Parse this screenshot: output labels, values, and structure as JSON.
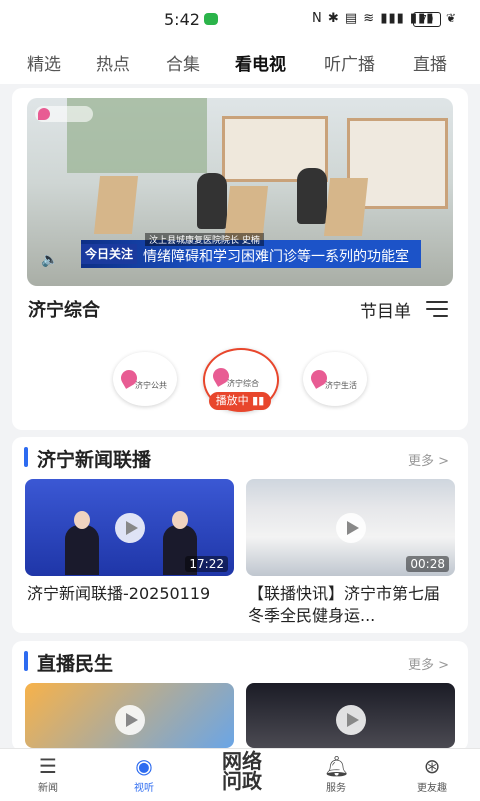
{
  "status": {
    "time": "5:42",
    "icons": "N ✱ ▤ ≋ ▮▮▮ ▮▮▮",
    "battery": "70"
  },
  "tabs": [
    {
      "label": "精选"
    },
    {
      "label": "热点"
    },
    {
      "label": "合集"
    },
    {
      "label": "看电视",
      "active": true
    },
    {
      "label": "听广播"
    },
    {
      "label": "直播"
    }
  ],
  "player": {
    "tag": "今日关注",
    "name_caption": "汶上县城康复医院院长 史楠",
    "caption": "情绪障碍和学习困难门诊等一系列的功能室"
  },
  "channel": {
    "current": "济宁综合",
    "program_guide": "节目单",
    "options": [
      "济宁公共",
      "济宁综合",
      "济宁生活"
    ],
    "playing_badge": "播放中 ▮▮"
  },
  "section_news": {
    "title": "济宁新闻联播",
    "more": "更多 >",
    "videos": [
      {
        "title": "济宁新闻联播-20250119",
        "duration": "17:22"
      },
      {
        "title": "【联播快讯】济宁市第七届冬季全民健身运...",
        "duration": "00:28"
      }
    ]
  },
  "section_live": {
    "title": "直播民生",
    "more": "更多 >"
  },
  "bottom_nav": {
    "items": [
      "新闻",
      "视听",
      "服务",
      "更友趣"
    ],
    "center": "网络\n问政"
  },
  "colors": {
    "accent": "#2d6bf0",
    "live_red": "#e8462c",
    "brand_pink": "#e85c93"
  }
}
